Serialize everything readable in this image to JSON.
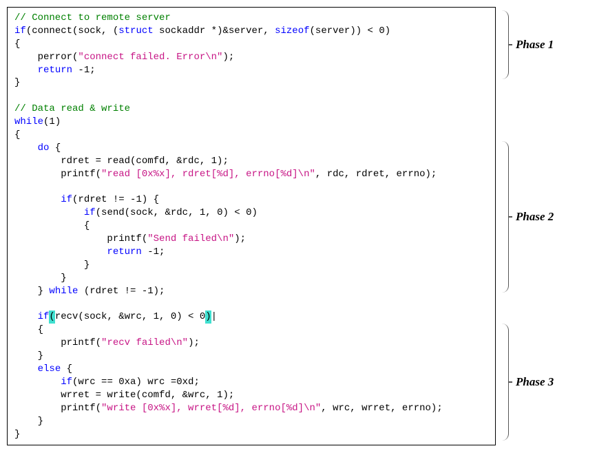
{
  "phases": {
    "p1": {
      "label": "Phase 1"
    },
    "p2": {
      "label": "Phase 2"
    },
    "p3": {
      "label": "Phase 3"
    }
  },
  "code": {
    "l0": "// Connect to remote server",
    "l1a": "if",
    "l1b": "(connect(sock, (",
    "l1c": "struct",
    "l1d": " sockaddr *)&server, ",
    "l1e": "sizeof",
    "l1f": "(server)) < 0)",
    "l2": "{",
    "l3a": "    perror(",
    "l3b": "\"connect failed. Error\\n\"",
    "l3c": ");",
    "l4a": "    ",
    "l4b": "return",
    "l4c": " -1;",
    "l5": "}",
    "l6": "",
    "l7": "// Data read & write",
    "l8a": "while",
    "l8b": "(1)",
    "l9": "{",
    "l10a": "    ",
    "l10b": "do",
    "l10c": " {",
    "l11": "        rdret = read(comfd, &rdc, 1);",
    "l12a": "        printf(",
    "l12b": "\"read [0x%x], rdret[%d], errno[%d]\\n\"",
    "l12c": ", rdc, rdret, errno);",
    "l13": "",
    "l14a": "        ",
    "l14b": "if",
    "l14c": "(rdret != -1) {",
    "l15a": "            ",
    "l15b": "if",
    "l15c": "(send(sock, &rdc, 1, 0) < 0)",
    "l16": "            {",
    "l17a": "                printf(",
    "l17b": "\"Send failed\\n\"",
    "l17c": ");",
    "l18a": "                ",
    "l18b": "return",
    "l18c": " -1;",
    "l19": "            }",
    "l20": "        }",
    "l21a": "    } ",
    "l21b": "while",
    "l21c": " (rdret != -1);",
    "l22": "",
    "l23a": "    ",
    "l23b": "if",
    "l23c1": "(",
    "l23c2": "recv(sock, &wrc, 1, 0) < 0",
    "l23c3": ")",
    "l23d": "|",
    "l24": "    {",
    "l25a": "        printf(",
    "l25b": "\"recv failed\\n\"",
    "l25c": ");",
    "l26": "    }",
    "l27a": "    ",
    "l27b": "else",
    "l27c": " {",
    "l28a": "        ",
    "l28b": "if",
    "l28c": "(wrc == 0xa) wrc =0xd;",
    "l29": "        wrret = write(comfd, &wrc, 1);",
    "l30a": "        printf(",
    "l30b": "\"write [0x%x], wrret[%d], errno[%d]\\n\"",
    "l30c": ", wrc, wrret, errno);",
    "l31": "    }",
    "l32": "}"
  }
}
